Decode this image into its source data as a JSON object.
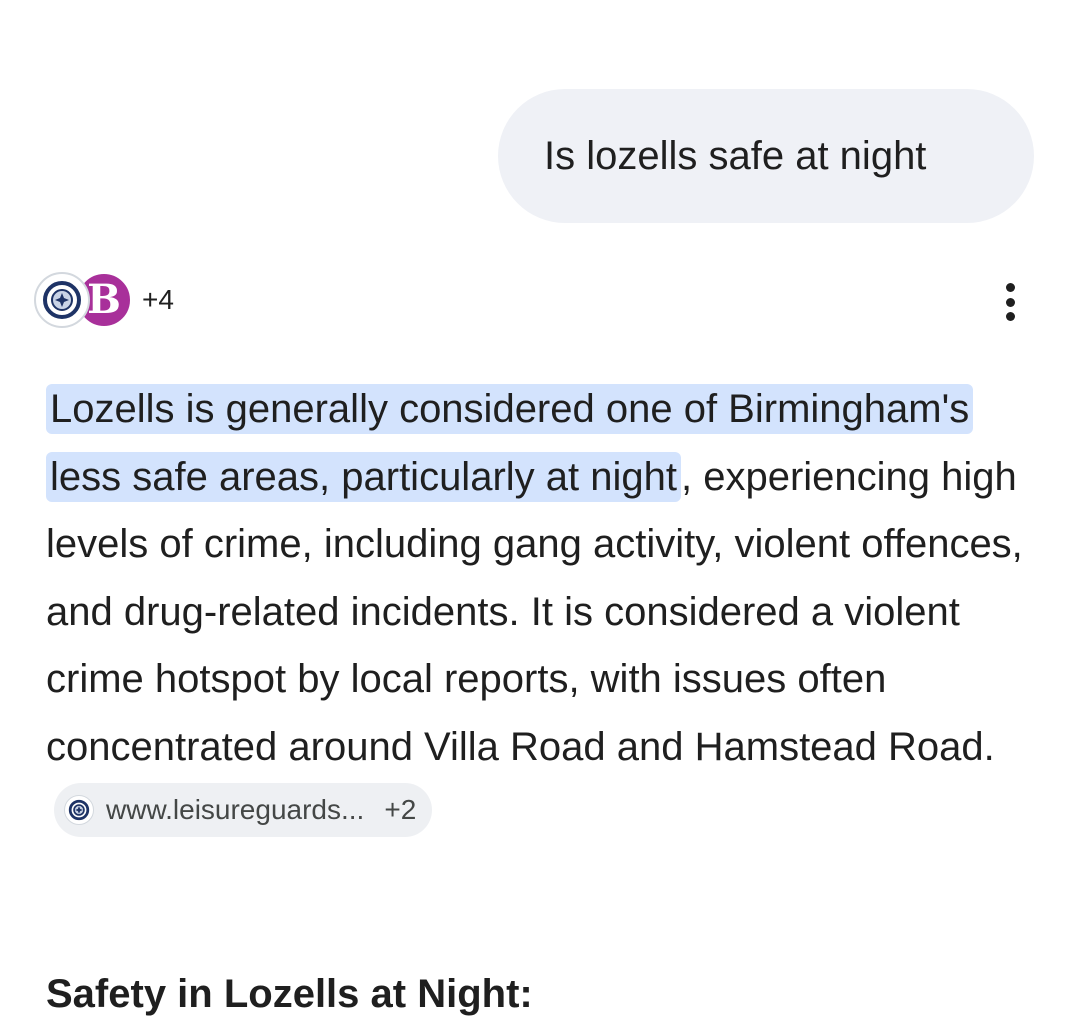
{
  "query": {
    "text": "Is lozells safe at night"
  },
  "sources": {
    "icons": [
      "police-badge-icon",
      "b-logo-icon"
    ],
    "more_count": "+4",
    "brand_color": "#a8309a"
  },
  "answer": {
    "highlighted": "Lozells is generally considered one of Birmingham's less safe areas, particularly at night",
    "body": ", experiencing high levels of crime, including gang activity, violent offences, and drug-related incidents. It is considered a violent crime hotspot by local reports, with issues often concentrated around Villa Road and Hamstead Road.",
    "highlight_color": "#d3e3fd"
  },
  "citation": {
    "site": "www.leisureguards...",
    "count": "+2"
  },
  "section": {
    "heading": "Safety in Lozells at Night:"
  }
}
